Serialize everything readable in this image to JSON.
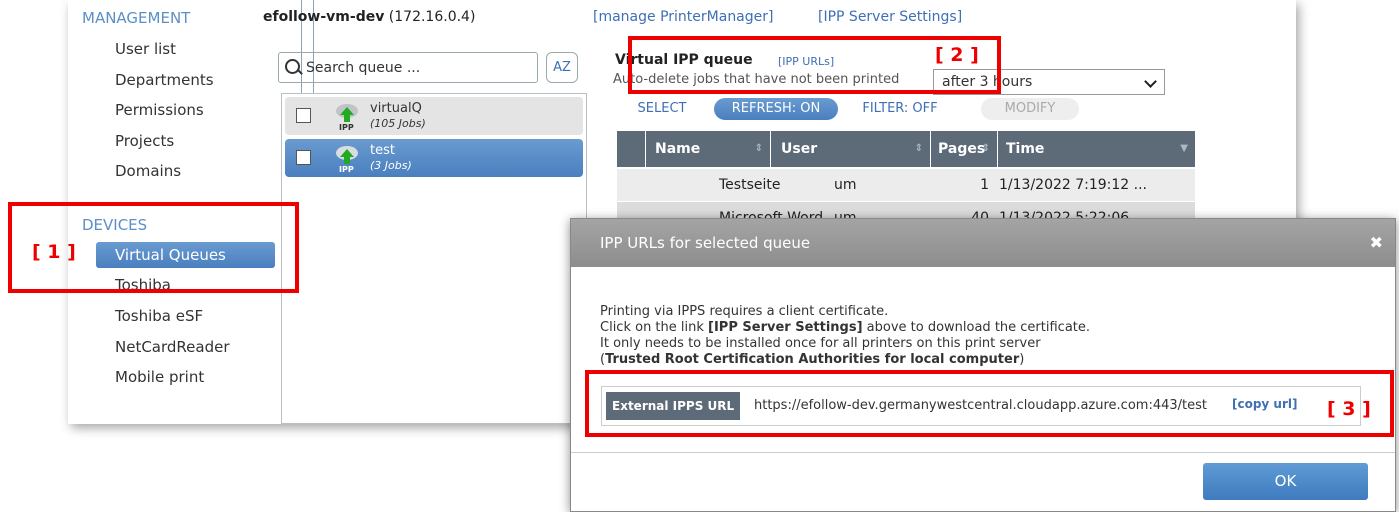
{
  "sidebar": {
    "management_header": "MANAGEMENT",
    "management_items": [
      {
        "label": "User list"
      },
      {
        "label": "Departments"
      },
      {
        "label": "Permissions"
      },
      {
        "label": "Projects"
      },
      {
        "label": "Domains"
      }
    ],
    "devices_header": "DEVICES",
    "devices_items": [
      {
        "label": "Virtual Queues",
        "active": true
      },
      {
        "label": "Toshiba"
      },
      {
        "label": "Toshiba eSF"
      },
      {
        "label": "NetCardReader"
      },
      {
        "label": "Mobile print"
      }
    ]
  },
  "topbar": {
    "server_name": "efollow-vm-dev",
    "server_ip": "(172.16.0.4)",
    "manage_link": "[manage PrinterManager]",
    "ipp_settings_link": "[IPP Server Settings]"
  },
  "queue_panel": {
    "search_placeholder": "Search queue ...",
    "sort_label": "AZ",
    "queues": [
      {
        "name": "virtualQ",
        "jobs": "(105 Jobs)",
        "icon_label": "IPP",
        "selected": false
      },
      {
        "name": "test",
        "jobs": "(3 Jobs)",
        "icon_label": "IPP",
        "selected": true
      }
    ]
  },
  "detail": {
    "title": "Virtual IPP queue",
    "ipp_urls_link": "[IPP URLs]",
    "auto_delete_label": "Auto-delete jobs that have not been printed",
    "auto_delete_value": "after 3 hours",
    "buttons": {
      "select": "SELECT",
      "refresh": "REFRESH: ON",
      "filter": "FILTER: OFF",
      "modify": "MODIFY"
    },
    "columns": [
      "Name",
      "User",
      "Pages",
      "Time"
    ],
    "rows": [
      {
        "name": "Testseite",
        "user": "um",
        "pages": "1",
        "time": "1/13/2022 7:19:12 ..."
      },
      {
        "name": "Microsoft Word ...",
        "user": "um",
        "pages": "40",
        "time": "1/13/2022 5:22:06 ..."
      }
    ]
  },
  "annotations": {
    "one": "[ 1 ]",
    "two": "[ 2 ]",
    "three": "[ 3 ]",
    "color": "#e00000"
  },
  "dialog": {
    "title": "IPP URLs for selected queue",
    "close_icon": "✖",
    "line1": "Printing via IPPS requires a client certificate.",
    "line2_pre": "Click on the link ",
    "line2_bold": "[IPP Server Settings]",
    "line2_post": " above to download the certificate.",
    "line3": "It only needs to be installed once for all printers on this print server",
    "line4_open": "(",
    "line4_bold": "Trusted Root Certification Authorities for local computer",
    "line4_close": ")",
    "url_label": "External IPPS URL",
    "url_value": "https://efollow-dev.germanywestcentral.cloudapp.azure.com:443/test",
    "copy_link": "[copy url]",
    "ok_button": "OK"
  }
}
